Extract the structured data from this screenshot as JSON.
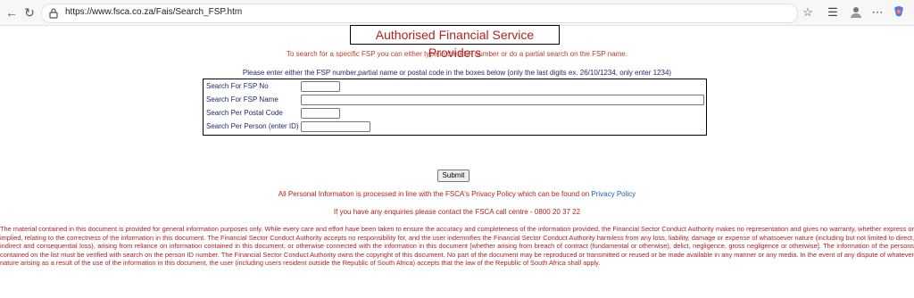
{
  "browser": {
    "url": "https://www.fsca.co.za/Fais/Search_FSP.htm"
  },
  "page": {
    "title": "Authorised Financial Service Providers",
    "instruction": "To search for a specific FSP you can either type in the FSP number or do a partial search on the FSP name.",
    "prompt": "Please enter either the FSP number,partial name or postal code in the boxes below (only the last digits ex. 26/10/1234, only enter 1234)",
    "form": {
      "fsp_no_label": "Search For FSP No",
      "fsp_name_label": "Search For FSP Name",
      "postal_label": "Search Per Postal Code",
      "person_label": "Search Per Person (enter ID)",
      "fsp_no_value": "",
      "fsp_name_value": "",
      "postal_value": "",
      "person_value": ""
    },
    "submit_label": "Submit",
    "privacy_text": "All Personal Information is processed in line with the FSCA's Privacy Policy which can be found on",
    "privacy_link": "Privacy Policy",
    "enquiry_text": "If you have any enquiries please contact the FSCA call centre - 0800 20 37 22",
    "disclaimer": "The material contained in this document is provided for general information purposes only. While every care and effort have been taken to ensure the accuracy and completeness of the information provided, the Financial Sector Conduct Authority makes no representation and gives no warranty, whether express or implied, relating to the correctness of the information in this document. The Financial Sector Conduct Authority accepts no responsibility for, and the user indemnifies the Financial Sector Conduct Authority harmless from any loss, liability, damage or expense of whatsoever nature (including but not limited to direct, indirect and consequential loss), arising from reliance on information contained in this document, or otherwise connected with the information in this document [whether arising from breach of contract (fundamental or otherwise), delict, negligence, gross negligence or otherwise]. The information of the persons contained on the list must be verified with search on the person ID number. The Financial Sector Conduct Authority owns the copyright of this document. No part of the document may be reproduced or transmitted or reused or be made available in any manner or any media. In the event of any dispute of whatever nature arising as a result of the use of the information in this document, the user (including users resident outside the Republic of South Africa) accepts that the law of the Republic of South Africa shall apply."
  },
  "colors": {
    "red_text": "#c0392b",
    "navy_text": "#1f2a6b",
    "link": "#1f5fa8"
  }
}
